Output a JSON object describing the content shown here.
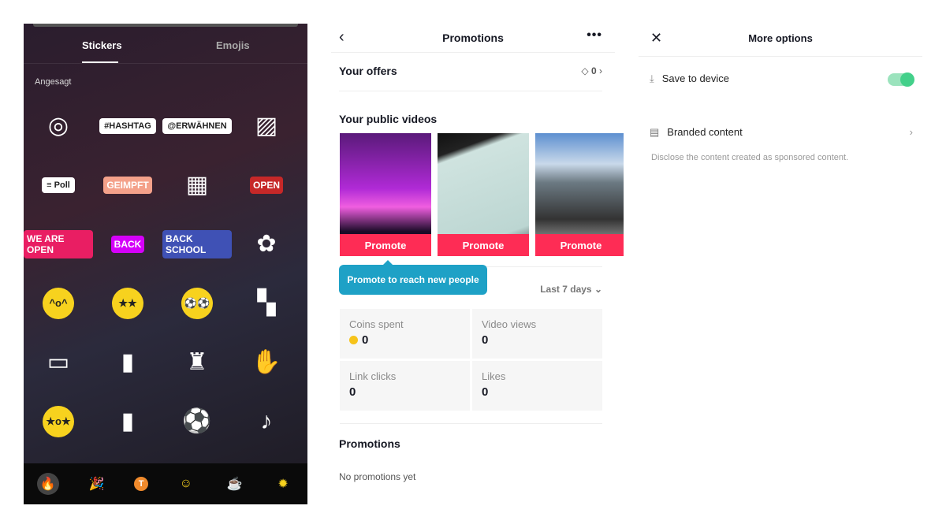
{
  "stickers_panel": {
    "tabs": [
      "Stickers",
      "Emojis"
    ],
    "section": "Angesagt",
    "items": [
      {
        "name": "camera-sticker",
        "type": "icon",
        "glyph": "◎"
      },
      {
        "name": "hashtag-sticker",
        "type": "pill",
        "text": "#HASHTAG"
      },
      {
        "name": "mention-sticker",
        "type": "pill",
        "text": "@ERWÄHNEN"
      },
      {
        "name": "image-add-sticker",
        "type": "icon",
        "glyph": "▨"
      },
      {
        "name": "poll-sticker",
        "type": "pill",
        "text": "≡ Poll"
      },
      {
        "name": "geimpft-sticker",
        "type": "label",
        "text": "GEIMPFT",
        "color": "#f4a18a"
      },
      {
        "name": "office-sticker",
        "type": "icon",
        "glyph": "▦"
      },
      {
        "name": "open-sign-sticker",
        "type": "label",
        "text": "OPEN",
        "color": "#c62828"
      },
      {
        "name": "we-are-open-sticker",
        "type": "label",
        "text": "WE ARE OPEN",
        "color": "#e91e63"
      },
      {
        "name": "back-to-work-sticker",
        "type": "label",
        "text": "BACK",
        "color": "#d500f9"
      },
      {
        "name": "back-to-school-sticker",
        "type": "label",
        "text": "BACK SCHOOL",
        "color": "#3f51b5"
      },
      {
        "name": "flower-sticker",
        "type": "icon",
        "glyph": "✿"
      },
      {
        "name": "party-face-sticker",
        "type": "face",
        "text": "^o^"
      },
      {
        "name": "star-eyes-sticker",
        "type": "face",
        "text": "★★"
      },
      {
        "name": "soccer-eyes-sticker",
        "type": "face",
        "text": "⚽⚽"
      },
      {
        "name": "checker-flag-sticker",
        "type": "icon",
        "glyph": "▚"
      },
      {
        "name": "soccer-field-sticker",
        "type": "icon",
        "glyph": "▭"
      },
      {
        "name": "red-card-sticker",
        "type": "icon",
        "glyph": "▮"
      },
      {
        "name": "referee-sticker",
        "type": "icon",
        "glyph": "♜"
      },
      {
        "name": "goalkeeper-glove-sticker",
        "type": "icon",
        "glyph": "✋"
      },
      {
        "name": "surprised-star-face-sticker",
        "type": "face",
        "text": "★o★"
      },
      {
        "name": "yellow-card-sticker",
        "type": "icon",
        "glyph": "▮"
      },
      {
        "name": "soccer-boot-sticker",
        "type": "icon",
        "glyph": "⚽"
      },
      {
        "name": "whistle-sticker",
        "type": "icon",
        "glyph": "♪"
      }
    ],
    "bottom_icons": [
      "fire",
      "party-popper",
      "t-coin",
      "grinning-face",
      "coffee",
      "sun"
    ]
  },
  "promotions": {
    "title": "Promotions",
    "offers_label": "Your offers",
    "offers_count": "0",
    "videos_label": "Your public videos",
    "promote_label": "Promote",
    "tooltip": "Promote to reach new people",
    "range": "Last 7 days",
    "stats": [
      {
        "label": "Coins spent",
        "value": "0"
      },
      {
        "label": "Video views",
        "value": "0"
      },
      {
        "label": "Link clicks",
        "value": "0"
      },
      {
        "label": "Likes",
        "value": "0"
      }
    ],
    "section": "Promotions",
    "empty": "No promotions yet",
    "accent": "#fe2c55",
    "tooltip_color": "#1ea1c6"
  },
  "options": {
    "title": "More options",
    "save": "Save to device",
    "save_enabled": true,
    "branded": "Branded content",
    "branded_desc": "Disclose the content created as sponsored content.",
    "toggle_color": "#43d08a"
  }
}
